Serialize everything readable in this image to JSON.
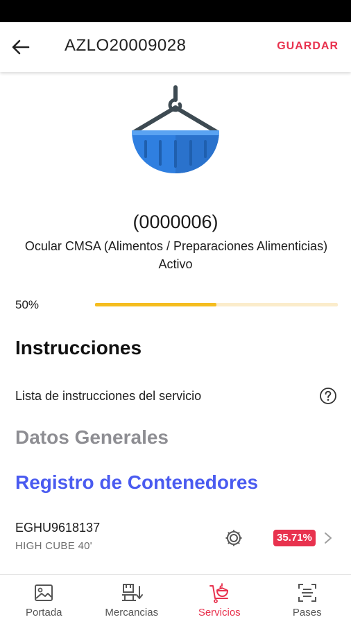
{
  "app_bar": {
    "title": "AZLO20009028",
    "save_label": "GUARDAR"
  },
  "service": {
    "code": "(0000006)",
    "description": "Ocular CMSA (Alimentos / Preparaciones Alimenticias)",
    "status": "Activo",
    "progress_label": "50%",
    "progress_fraction": 0.5
  },
  "instructions": {
    "title": "Instrucciones",
    "list_label": "Lista de instrucciones del servicio"
  },
  "sections": {
    "general": "Datos Generales",
    "registry": "Registro de Contenedores"
  },
  "container": {
    "id": "EGHU9618137",
    "type": "HIGH CUBE 40'",
    "percent": "35.71%"
  },
  "bottom_nav": {
    "items": [
      {
        "label": "Portada",
        "icon": "image-icon"
      },
      {
        "label": "Mercancias",
        "icon": "goods-icon"
      },
      {
        "label": "Servicios",
        "icon": "service-icon"
      },
      {
        "label": "Pases",
        "icon": "scan-icon"
      }
    ],
    "active_index": 2
  },
  "colors": {
    "accent": "#e8324e",
    "link": "#4a5bf0",
    "progress": "#f5bd1f",
    "progress_track": "#fbeccb",
    "hero_blue": "#2f7fe0"
  }
}
